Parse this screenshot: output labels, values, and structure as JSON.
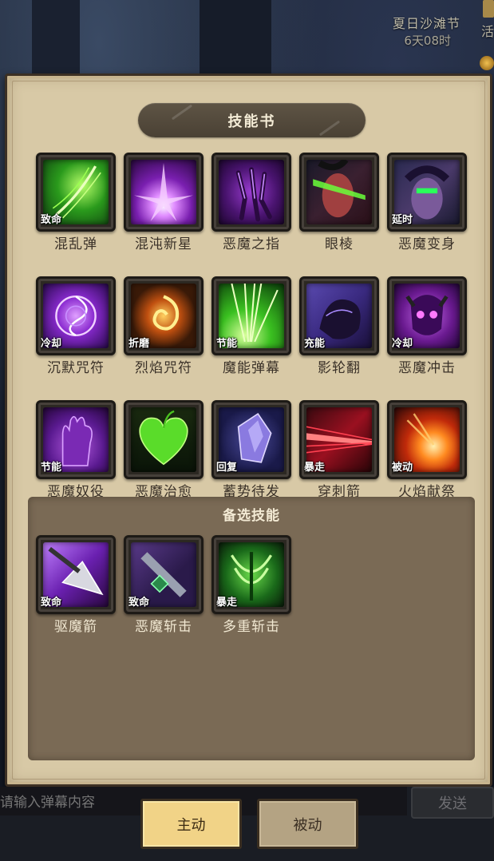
{
  "event": {
    "title": "夏日沙滩节",
    "timer": "6天08时",
    "side_label": "活"
  },
  "panel": {
    "title": "技能书"
  },
  "skills": [
    {
      "name": "混乱弹",
      "tag": "致命",
      "icon": "green-slash-icon"
    },
    {
      "name": "混沌新星",
      "tag": "",
      "icon": "purple-nova-icon"
    },
    {
      "name": "恶魔之指",
      "tag": "",
      "icon": "demon-claw-icon"
    },
    {
      "name": "眼棱",
      "tag": "",
      "icon": "eye-beam-icon"
    },
    {
      "name": "恶魔变身",
      "tag": "延时",
      "icon": "demon-form-icon"
    },
    {
      "name": "沉默咒符",
      "tag": "冷却",
      "icon": "silence-sigil-icon"
    },
    {
      "name": "烈焰咒符",
      "tag": "折磨",
      "icon": "flame-sigil-icon"
    },
    {
      "name": "魔能弹幕",
      "tag": "节能",
      "icon": "fel-barrage-icon"
    },
    {
      "name": "影轮翻",
      "tag": "充能",
      "icon": "shadow-roll-icon"
    },
    {
      "name": "恶魔冲击",
      "tag": "冷却",
      "icon": "demon-skull-icon"
    },
    {
      "name": "恶魔奴役",
      "tag": "节能",
      "icon": "demon-hand-icon"
    },
    {
      "name": "恶魔治愈",
      "tag": "",
      "icon": "green-heart-icon"
    },
    {
      "name": "蓄势待发",
      "tag": "回复",
      "icon": "crystal-icon"
    },
    {
      "name": "穿刺箭",
      "tag": "暴走",
      "icon": "red-streak-icon"
    },
    {
      "name": "火焰献祭",
      "tag": "被动",
      "icon": "fireball-icon"
    }
  ],
  "backup": {
    "title": "备选技能",
    "skills": [
      {
        "name": "驱魔箭",
        "tag": "致命",
        "icon": "arrowhead-icon"
      },
      {
        "name": "恶魔斩击",
        "tag": "致命",
        "icon": "demon-blade-icon"
      },
      {
        "name": "多重斩击",
        "tag": "暴走",
        "icon": "multi-slash-icon"
      }
    ]
  },
  "bottom": {
    "chat_placeholder": "请输入弹幕内容",
    "send_label": "发送",
    "tab_active": "主动",
    "tab_inactive": "被动"
  }
}
